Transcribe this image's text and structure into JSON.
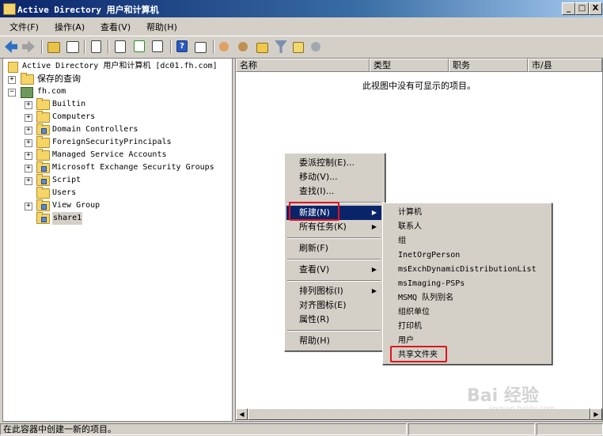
{
  "window": {
    "title": "Active Directory 用户和计算机",
    "min": "_",
    "max": "□",
    "close": "X"
  },
  "menubar": [
    "文件(F)",
    "操作(A)",
    "查看(V)",
    "帮助(H)"
  ],
  "toolbar_icons": [
    "back-icon",
    "forward-icon",
    "up-icon",
    "show-tree-icon",
    "copy-icon",
    "export-list-icon",
    "refresh-icon",
    "export-icon",
    "help-icon",
    "properties-icon",
    "new-user-icon",
    "new-group-icon",
    "new-ou-icon",
    "filter-icon",
    "find-icon",
    "add-member-icon"
  ],
  "tree": {
    "root": "Active Directory 用户和计算机 [dc01.fh.com]",
    "saved_queries": "保存的查询",
    "domain": "fh.com",
    "items": [
      {
        "label": "Builtin",
        "expand": "+",
        "icon": "folder"
      },
      {
        "label": "Computers",
        "expand": "+",
        "icon": "folder"
      },
      {
        "label": "Domain Controllers",
        "expand": "+",
        "icon": "ou"
      },
      {
        "label": "ForeignSecurityPrincipals",
        "expand": "+",
        "icon": "folder"
      },
      {
        "label": "Managed Service Accounts",
        "expand": "+",
        "icon": "folder"
      },
      {
        "label": "Microsoft Exchange Security Groups",
        "expand": "+",
        "icon": "ou"
      },
      {
        "label": "Script",
        "expand": "+",
        "icon": "ou"
      },
      {
        "label": "Users",
        "expand": "",
        "icon": "folder"
      },
      {
        "label": "View Group",
        "expand": "+",
        "icon": "ou"
      },
      {
        "label": "share1",
        "expand": "",
        "icon": "ou",
        "selected": true
      }
    ]
  },
  "list": {
    "columns": [
      "名称",
      "类型",
      "职务",
      "市/县"
    ],
    "empty_message": "此视图中没有可显示的项目。"
  },
  "context_menu": {
    "items": [
      "委派控制(E)...",
      "移动(V)...",
      "查找(I)...",
      "新建(N)",
      "所有任务(K)",
      "刷新(F)",
      "查看(V)",
      "排列图标(I)",
      "对齐图标(E)",
      "属性(R)",
      "帮助(H)"
    ],
    "highlighted": "新建(N)"
  },
  "submenu": {
    "items": [
      "计算机",
      "联系人",
      "组",
      "InetOrgPerson",
      "msExchDynamicDistributionList",
      "msImaging-PSPs",
      "MSMQ 队列别名",
      "组织单位",
      "打印机",
      "用户",
      "共享文件夹"
    ],
    "annotated": "共享文件夹"
  },
  "status": {
    "text": "在此容器中创建一新的项目。"
  },
  "watermark": {
    "logo": "Bai 经验",
    "url": "jingyan.baidu.com"
  },
  "colors": {
    "highlight": "#0a246a",
    "annotation": "#e0141e",
    "chrome": "#d4d0c8"
  }
}
